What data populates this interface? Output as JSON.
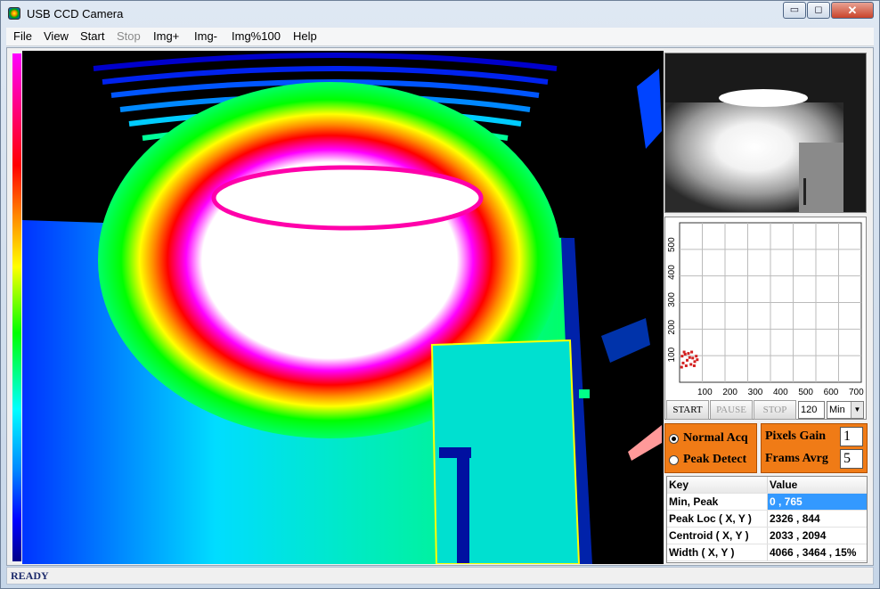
{
  "window": {
    "title": "USB CCD Camera",
    "minimize_glyph": "▭",
    "restore_glyph": "◻",
    "close_glyph": "✕"
  },
  "menu": [
    {
      "label": "File",
      "enabled": true
    },
    {
      "label": "View",
      "enabled": true
    },
    {
      "label": "Start",
      "enabled": true
    },
    {
      "label": "Stop",
      "enabled": false
    },
    {
      "label": "Img+",
      "enabled": true
    },
    {
      "label": "Img-",
      "enabled": true
    },
    {
      "label": "Img%100",
      "enabled": true
    },
    {
      "label": "Help",
      "enabled": true
    }
  ],
  "scatter": {
    "y_ticks": [
      "100",
      "200",
      "300",
      "400",
      "500"
    ],
    "x_ticks": [
      "100",
      "200",
      "300",
      "400",
      "500",
      "600",
      "700"
    ],
    "xlim": [
      0,
      720
    ],
    "ylim": [
      0,
      580
    ],
    "point_color": "#d32020",
    "points": [
      [
        10,
        95
      ],
      [
        22,
        102
      ],
      [
        30,
        80
      ],
      [
        14,
        70
      ],
      [
        40,
        90
      ],
      [
        52,
        88
      ],
      [
        26,
        60
      ],
      [
        60,
        75
      ],
      [
        66,
        95
      ],
      [
        18,
        110
      ],
      [
        45,
        65
      ],
      [
        35,
        105
      ],
      [
        58,
        60
      ],
      [
        70,
        82
      ],
      [
        8,
        55
      ],
      [
        48,
        110
      ]
    ]
  },
  "controls": {
    "start_label": "START",
    "pause_label": "PAUSE",
    "stop_label": "STOP",
    "count_value": "120",
    "mode_value": "Min",
    "dropdown_glyph": "▼"
  },
  "acq": {
    "normal_label": "Normal Acq",
    "peak_label": "Peak Detect",
    "selected": "normal",
    "gain_label": "Pixels Gain",
    "gain_value": "1",
    "avg_label": "Frams Avrg",
    "avg_value": "5"
  },
  "table": {
    "headers": [
      "Key",
      "Value"
    ],
    "rows": [
      {
        "key": "Min, Peak",
        "value": "0 , 765",
        "selected": true
      },
      {
        "key": "Peak Loc ( X, Y )",
        "value": "2326 , 844",
        "selected": false
      },
      {
        "key": "Centroid ( X, Y )",
        "value": "2033 , 2094",
        "selected": false
      },
      {
        "key": "Width ( X, Y )",
        "value": "4066 , 3464 , 15%",
        "selected": false
      }
    ]
  },
  "status": {
    "text": "READY"
  },
  "colors": {
    "accent_orange": "#f07b16",
    "selection_blue": "#3399ff",
    "status_text": "#1c2a6b"
  }
}
